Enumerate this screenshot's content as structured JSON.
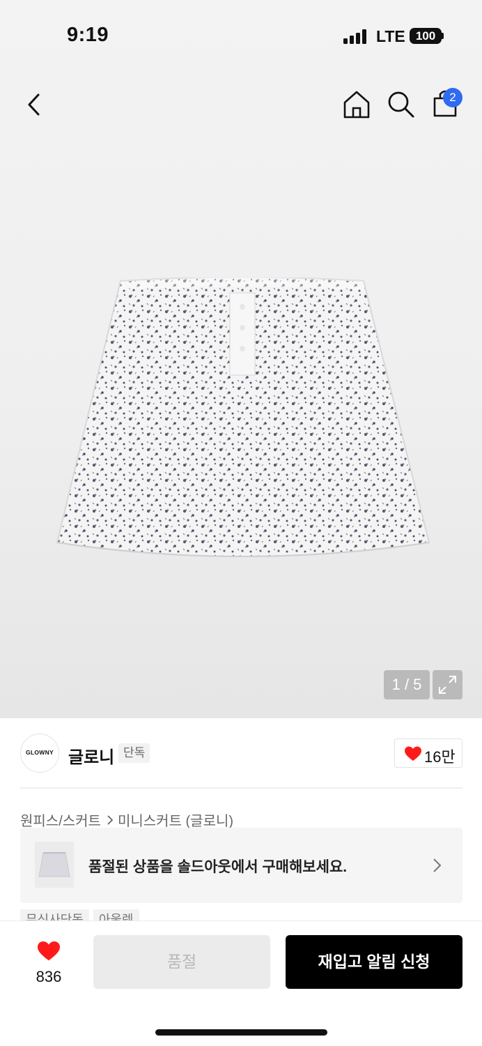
{
  "status_bar": {
    "time": "9:19",
    "network": "LTE",
    "battery": "100"
  },
  "nav": {
    "back_icon": "chevron-left-icon",
    "home_icon": "home-icon",
    "search_icon": "search-icon",
    "cart_icon": "shopping-bag-icon",
    "cart_count": "2",
    "badge_color": "#2f6bf0"
  },
  "gallery": {
    "counter": "1 / 5",
    "expand_icon": "expand-icon"
  },
  "brand": {
    "logo_text": "GLOWNY",
    "name": "글로니",
    "tag": "단독",
    "likes": "16만",
    "heart_color": "#ff1a1a"
  },
  "breadcrumb": {
    "category": "원피스/스커트",
    "subcategory": "미니스커트 (글로니)"
  },
  "soldout_banner": {
    "text": "품절된 상품을 솔드아웃에서 구매해보세요."
  },
  "tags": [
    "무신사단독",
    "아울렛"
  ],
  "bottom_bar": {
    "like_count": "836",
    "soldout_label": "품절",
    "restock_label": "재입고 알림 신청"
  }
}
